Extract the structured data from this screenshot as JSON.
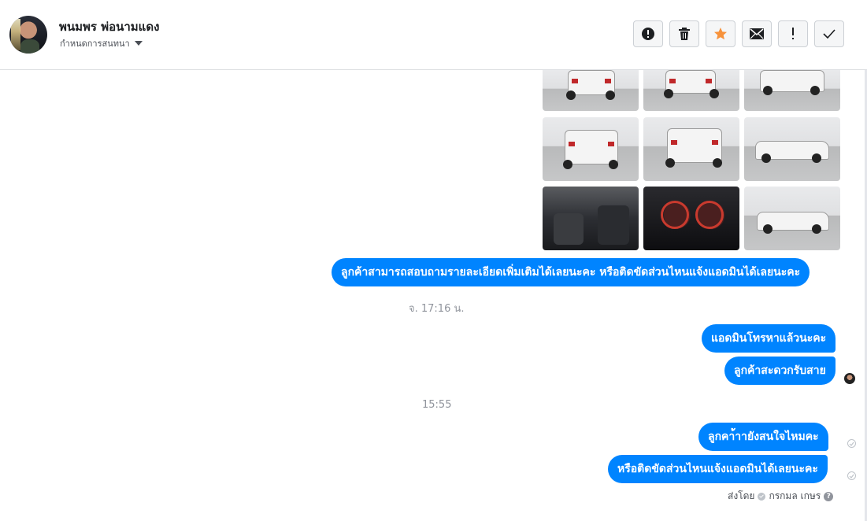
{
  "header": {
    "contact_name": "พนมพร พ่อนามแดง",
    "convo_label": "กำหนดการสนทนา",
    "actions": [
      {
        "name": "report-spam-button",
        "icon": "alert-circle-icon"
      },
      {
        "name": "delete-button",
        "icon": "trash-icon"
      },
      {
        "name": "star-button",
        "icon": "star-icon",
        "color": "#f7923b"
      },
      {
        "name": "mark-unread-button",
        "icon": "envelope-icon"
      },
      {
        "name": "follow-up-button",
        "icon": "exclamation-icon"
      },
      {
        "name": "mark-done-button",
        "icon": "check-icon"
      }
    ]
  },
  "photos": [
    {
      "kind": "truck-front"
    },
    {
      "kind": "truck-rear-angle"
    },
    {
      "kind": "truck-front-angle"
    },
    {
      "kind": "truck-rear"
    },
    {
      "kind": "truck-rear-angle"
    },
    {
      "kind": "truck-side"
    },
    {
      "kind": "interior-seat"
    },
    {
      "kind": "gauge-cluster"
    },
    {
      "kind": "truck-side"
    }
  ],
  "messages": {
    "m1": "ลูกค้าสามารถสอบถามรายละเอียดเพิ่มเติมได้เลยนะคะ หรือติดขัดส่วนไหนแจ้งแอดมินได้เลยนะคะ",
    "ts1": "จ. 17:16 น.",
    "m2": "แอดมินโทรหาแล้วนะคะ",
    "m3": "ลูกค้าสะดวกรับสาย",
    "ts2": "15:55",
    "m4": "ลูกคา้าายังสนใจไหมคะ",
    "m5": "หรือติดขัดส่วนไหนแจ้งแอดมินได้เลยนะคะ"
  },
  "sent_by": {
    "label": "ส่งโดย",
    "name": "กรกมล เกษร"
  },
  "colors": {
    "bubble": "#0084ff",
    "star": "#f7923b"
  }
}
